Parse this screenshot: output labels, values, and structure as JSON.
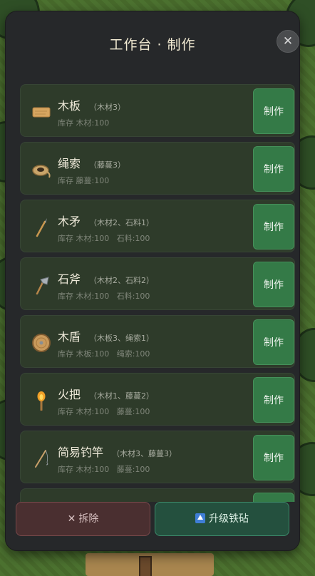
{
  "title": "工作台 · 制作",
  "close_label": "✕",
  "craft_label": "制作",
  "items": [
    {
      "name": "木板",
      "req": "（木材3）",
      "stock": "库存 木材:100",
      "icon": "wood-plank-icon"
    },
    {
      "name": "绳索",
      "req": "（藤蔓3）",
      "stock": "库存 藤蔓:100",
      "icon": "rope-coil-icon"
    },
    {
      "name": "木矛",
      "req": "（木材2、石料1）",
      "stock": "库存 木材:100   石料:100",
      "icon": "wooden-spear-icon"
    },
    {
      "name": "石斧",
      "req": "（木材2、石料2）",
      "stock": "库存 木材:100   石料:100",
      "icon": "stone-axe-icon"
    },
    {
      "name": "木盾",
      "req": "（木板3、绳索1）",
      "stock": "库存 木板:100   绳索:100",
      "icon": "wooden-shield-icon"
    },
    {
      "name": "火把",
      "req": "（木材1、藤蔓2）",
      "stock": "库存 木材:100   藤蔓:100",
      "icon": "torch-icon"
    },
    {
      "name": "简易钓竿",
      "req": "（木材3、藤蔓3）",
      "stock": "库存 木材:100   藤蔓:100",
      "icon": "fishing-rod-icon"
    }
  ],
  "buttons": {
    "dismantle_icon": "✕",
    "dismantle": "拆除",
    "upgrade": "升级铁砧"
  },
  "colors": {
    "panel": "#26282a",
    "item_bg": "#2e3b2a",
    "craft_button": "#347a47",
    "dismantle_button": "#4a2f30",
    "upgrade_button": "#24503e"
  }
}
